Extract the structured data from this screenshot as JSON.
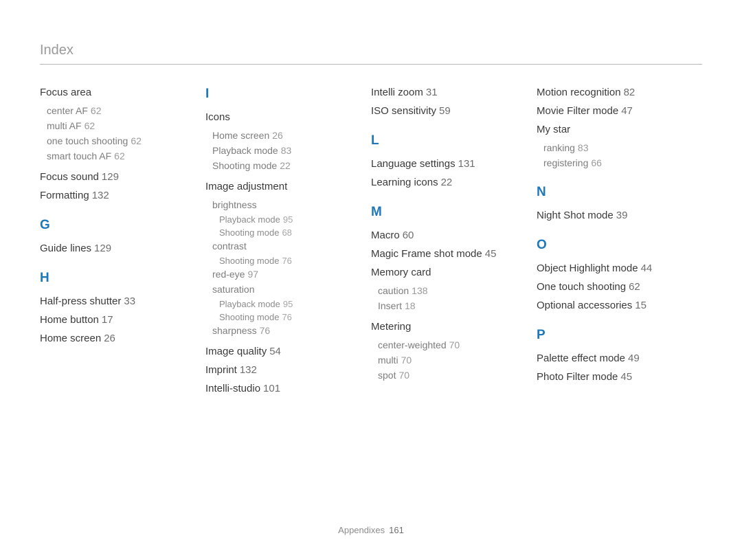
{
  "header": {
    "title": "Index"
  },
  "footer": {
    "section": "Appendixes",
    "page": "161"
  },
  "col1": {
    "e1": {
      "label": "Focus area"
    },
    "e1s1": {
      "label": "center AF",
      "pg": "62"
    },
    "e1s2": {
      "label": "multi AF",
      "pg": "62"
    },
    "e1s3": {
      "label": "one touch shooting",
      "pg": "62"
    },
    "e1s4": {
      "label": "smart touch AF",
      "pg": "62"
    },
    "e2": {
      "label": "Focus sound",
      "pg": "129"
    },
    "e3": {
      "label": "Formatting",
      "pg": "132"
    },
    "lg": "G",
    "g1": {
      "label": "Guide lines",
      "pg": "129"
    },
    "lh": "H",
    "h1": {
      "label": "Half-press shutter",
      "pg": "33"
    },
    "h2": {
      "label": "Home button",
      "pg": "17"
    },
    "h3": {
      "label": "Home screen",
      "pg": "26"
    }
  },
  "col2": {
    "li": "I",
    "i1": {
      "label": "Icons"
    },
    "i1s1": {
      "label": "Home screen",
      "pg": "26"
    },
    "i1s2": {
      "label": "Playback mode",
      "pg": "83"
    },
    "i1s3": {
      "label": "Shooting mode",
      "pg": "22"
    },
    "i2": {
      "label": "Image adjustment"
    },
    "i2s1": {
      "label": "brightness"
    },
    "i2s1a": {
      "label": "Playback mode",
      "pg": "95"
    },
    "i2s1b": {
      "label": "Shooting mode",
      "pg": "68"
    },
    "i2s2": {
      "label": "contrast"
    },
    "i2s2a": {
      "label": "Shooting mode",
      "pg": "76"
    },
    "i2s3": {
      "label": "red-eye",
      "pg": "97"
    },
    "i2s4": {
      "label": "saturation"
    },
    "i2s4a": {
      "label": "Playback mode",
      "pg": "95"
    },
    "i2s4b": {
      "label": "Shooting mode",
      "pg": "76"
    },
    "i2s5": {
      "label": "sharpness",
      "pg": "76"
    },
    "i3": {
      "label": "Image quality",
      "pg": "54"
    },
    "i4": {
      "label": "Imprint",
      "pg": "132"
    },
    "i5": {
      "label": "Intelli-studio",
      "pg": "101"
    }
  },
  "col3": {
    "c1": {
      "label": "Intelli zoom",
      "pg": "31"
    },
    "c2": {
      "label": "ISO sensitivity",
      "pg": "59"
    },
    "ll": "L",
    "l1": {
      "label": "Language settings",
      "pg": "131"
    },
    "l2": {
      "label": "Learning icons",
      "pg": "22"
    },
    "lm": "M",
    "m1": {
      "label": "Macro",
      "pg": "60"
    },
    "m2": {
      "label": "Magic Frame shot mode",
      "pg": "45"
    },
    "m3": {
      "label": "Memory card"
    },
    "m3s1": {
      "label": "caution",
      "pg": "138"
    },
    "m3s2": {
      "label": "Insert",
      "pg": "18"
    },
    "m4": {
      "label": "Metering"
    },
    "m4s1": {
      "label": "center-weighted",
      "pg": "70"
    },
    "m4s2": {
      "label": "multi",
      "pg": "70"
    },
    "m4s3": {
      "label": "spot",
      "pg": "70"
    }
  },
  "col4": {
    "d1": {
      "label": "Motion recognition",
      "pg": "82"
    },
    "d2": {
      "label": "Movie Filter mode",
      "pg": "47"
    },
    "d3": {
      "label": "My star"
    },
    "d3s1": {
      "label": "ranking",
      "pg": "83"
    },
    "d3s2": {
      "label": "registering",
      "pg": "66"
    },
    "ln": "N",
    "n1": {
      "label": "Night Shot mode",
      "pg": "39"
    },
    "lo": "O",
    "o1": {
      "label": "Object Highlight mode",
      "pg": "44"
    },
    "o2": {
      "label": "One touch shooting",
      "pg": "62"
    },
    "o3": {
      "label": "Optional accessories",
      "pg": "15"
    },
    "lp": "P",
    "p1": {
      "label": "Palette effect mode",
      "pg": "49"
    },
    "p2": {
      "label": "Photo Filter mode",
      "pg": "45"
    }
  }
}
